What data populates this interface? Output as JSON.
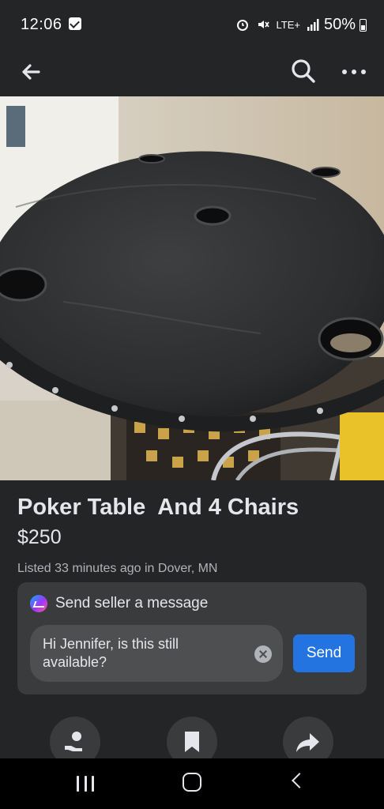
{
  "status_bar": {
    "time": "12:06",
    "network": "LTE+",
    "battery": "50%",
    "icons": [
      "checkbox-icon",
      "alarm-icon",
      "mute-icon",
      "signal-icon",
      "battery-icon"
    ]
  },
  "top_bar": {
    "icons": [
      "back-arrow-icon",
      "search-icon",
      "more-icon"
    ]
  },
  "listing": {
    "title": "Poker Table  And 4 Chairs",
    "price": "$250",
    "listed": "Listed 33 minutes ago in Dover, MN"
  },
  "message": {
    "header": "Send seller a message",
    "input_value": "Hi Jennifer, is this still available?",
    "send_label": "Send"
  },
  "actions": {
    "icons": [
      "seller-icon",
      "save-bookmark-icon",
      "share-icon"
    ]
  },
  "nav": {
    "icons": [
      "recent-apps-icon",
      "home-icon",
      "back-icon"
    ]
  },
  "colors": {
    "background": "#242526",
    "card": "#3a3b3c",
    "accent": "#2374e1"
  }
}
